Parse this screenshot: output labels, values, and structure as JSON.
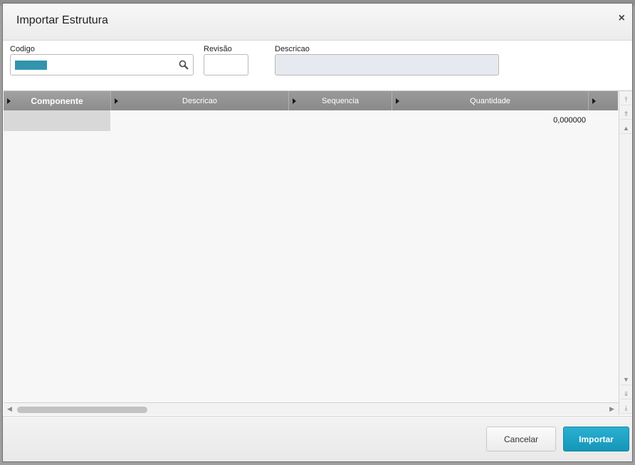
{
  "dialog": {
    "title": "Importar Estrutura",
    "close_label": "×"
  },
  "form": {
    "codigo_label": "Codigo",
    "codigo_value": "",
    "revisao_label": "Revisão",
    "revisao_value": "",
    "descricao_label": "Descricao",
    "descricao_value": ""
  },
  "grid": {
    "columns": [
      "Componente",
      "Descricao",
      "Sequencia",
      "Quantidade"
    ],
    "rows": [
      {
        "componente": "",
        "descricao": "",
        "sequencia": "",
        "quantidade": "0,000000"
      }
    ]
  },
  "footer": {
    "cancel_label": "Cancelar",
    "import_label": "Importar"
  },
  "colors": {
    "accent": "#1ea3c6",
    "header_gray": "#8f8f8f",
    "readonly_field": "#e6e9f0"
  },
  "icons": [
    "close-icon",
    "search-icon",
    "sort-arrow-icon",
    "scroll-arrow-icon"
  ]
}
